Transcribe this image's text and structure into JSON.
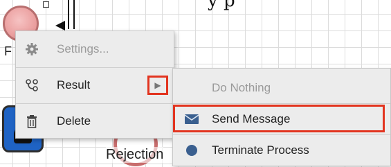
{
  "canvas": {
    "top_text": "y p",
    "start_node_label": "F",
    "end_node_label": "Rejection"
  },
  "context_menu": {
    "items": [
      {
        "label": "Settings...",
        "icon": "gear-icon",
        "enabled": false
      },
      {
        "label": "Result",
        "icon": "result-icon",
        "enabled": true,
        "has_submenu": true
      },
      {
        "label": "Delete",
        "icon": "trash-icon",
        "enabled": true
      }
    ]
  },
  "result_submenu": {
    "items": [
      {
        "label": "Do Nothing",
        "icon": "",
        "enabled": false
      },
      {
        "label": "Send Message",
        "icon": "envelope-icon",
        "enabled": true,
        "highlighted": true
      },
      {
        "label": "Terminate Process",
        "icon": "dot-icon",
        "enabled": true
      }
    ]
  },
  "colors": {
    "highlight": "#e2341f",
    "menu_bg": "#ececec"
  }
}
